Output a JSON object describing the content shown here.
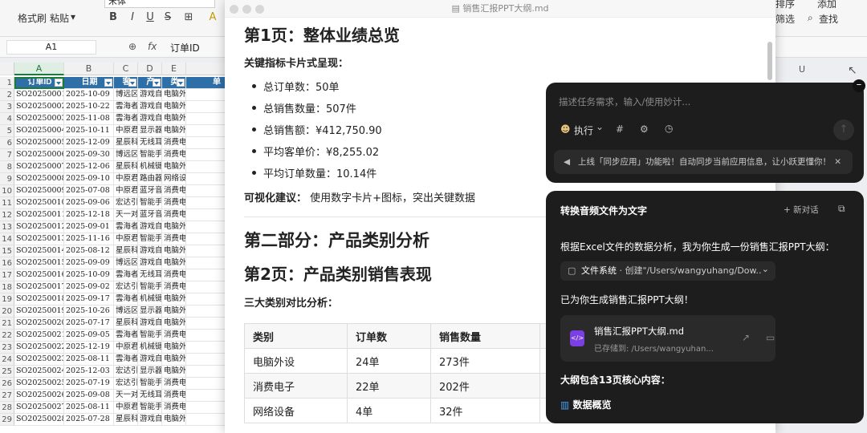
{
  "ribbon": {
    "format_painter": "格式刷",
    "paste": "粘贴",
    "paste_arrow": "▾",
    "font_name": "宋体",
    "bold": "B",
    "italic": "I",
    "underline": "U",
    "strike": "S",
    "border": "⊞",
    "fill": "A",
    "sort": "排序",
    "filter": "筛选",
    "find": "查找",
    "add": "添加"
  },
  "formula_bar": {
    "cell_ref": "A1",
    "fx": "fx",
    "zoom_icon": "⊕",
    "value": "订单ID"
  },
  "sheet": {
    "columns": [
      "A",
      "B",
      "C",
      "D",
      "E"
    ],
    "extra_columns": {
      "u": "U",
      "hidden_header": "单"
    },
    "header_row": [
      "订单ID",
      "日期",
      "客",
      "产",
      "类"
    ],
    "rows": [
      [
        "SO20250001",
        "2025-10-09",
        "博远区",
        "游戏自",
        "电脑外"
      ],
      [
        "SO20250002",
        "2025-10-22",
        "雲海者",
        "游戏自",
        "电脑外"
      ],
      [
        "SO20250003",
        "2025-11-08",
        "雲海者",
        "游戏自",
        "电脑外"
      ],
      [
        "SO20250004",
        "2025-10-11",
        "中原君",
        "显示器",
        "电脑外"
      ],
      [
        "SO20250005",
        "2025-12-09",
        "星辰科",
        "无线耳",
        "消费电"
      ],
      [
        "SO20250006",
        "2025-09-30",
        "博远区",
        "智能手",
        "消费电"
      ],
      [
        "SO20250007",
        "2025-12-06",
        "星辰科",
        "机械键",
        "电脑外"
      ],
      [
        "SO20250008",
        "2025-09-10",
        "中原君",
        "路由器",
        "网络设"
      ],
      [
        "SO20250009",
        "2025-07-08",
        "中原君",
        "蓝牙音",
        "消费电"
      ],
      [
        "SO20250010",
        "2025-09-06",
        "宏达引",
        "智能手",
        "消费电"
      ],
      [
        "SO20250011",
        "2025-12-18",
        "天一对",
        "蓝牙音",
        "消费电"
      ],
      [
        "SO20250012",
        "2025-09-01",
        "雲海者",
        "游戏自",
        "电脑外"
      ],
      [
        "SO20250013",
        "2025-11-16",
        "中原君",
        "智能手",
        "消费电"
      ],
      [
        "SO20250014",
        "2025-08-12",
        "星辰科",
        "游戏自",
        "电脑外"
      ],
      [
        "SO20250015",
        "2025-09-09",
        "博远区",
        "游戏自",
        "电脑外"
      ],
      [
        "SO20250016",
        "2025-10-09",
        "雲海者",
        "无线耳",
        "消费电"
      ],
      [
        "SO20250017",
        "2025-09-02",
        "宏达引",
        "智能手",
        "消费电"
      ],
      [
        "SO20250018",
        "2025-09-17",
        "雲海者",
        "机械键",
        "电脑外"
      ],
      [
        "SO20250019",
        "2025-10-26",
        "博远区",
        "显示器",
        "电脑外"
      ],
      [
        "SO20250020",
        "2025-07-17",
        "星辰科",
        "游戏自",
        "电脑外"
      ],
      [
        "SO20250021",
        "2025-09-05",
        "雲海者",
        "智能手",
        "消费电"
      ],
      [
        "SO20250022",
        "2025-12-19",
        "中原君",
        "机械键",
        "电脑外"
      ],
      [
        "SO20250023",
        "2025-08-11",
        "雲海者",
        "游戏自",
        "电脑外"
      ],
      [
        "SO20250024",
        "2025-12-03",
        "宏达引",
        "显示器",
        "电脑外"
      ],
      [
        "SO20250025",
        "2025-07-19",
        "宏达引",
        "智能手",
        "消费电"
      ],
      [
        "SO20250026",
        "2025-09-08",
        "天一对",
        "无线耳",
        "消费电"
      ],
      [
        "SO20250027",
        "2025-08-11",
        "中原君",
        "智能手",
        "消费电"
      ],
      [
        "SO20250028",
        "2025-07-28",
        "星辰科",
        "游戏自",
        "电脑外"
      ]
    ]
  },
  "markdown": {
    "window_title": "销售汇报PPT大纲.md",
    "page1_heading": "第1页：整体业绩总览",
    "kpi_intro": "关键指标卡片式呈现：",
    "kpis": [
      "总订单数：50单",
      "总销售数量：507件",
      "总销售额：¥412,750.90",
      "平均客单价：¥8,255.02",
      "平均订单数量：10.14件"
    ],
    "viz_label": "可视化建议：",
    "viz_text": "使用数字卡片+图标，突出关键数据",
    "part2_heading": "第二部分：产品类别分析",
    "page2_heading": "第2页：产品类别销售表现",
    "compare_intro": "三大类别对比分析：",
    "table_headers": [
      "类别",
      "订单数",
      "销售数量",
      "¥"
    ],
    "table_rows": [
      [
        "电脑外设",
        "24单",
        "273件",
        "¥"
      ],
      [
        "消费电子",
        "22单",
        "202件",
        "¥"
      ],
      [
        "网络设备",
        "4单",
        "32件",
        "¥"
      ]
    ]
  },
  "assistant": {
    "input_placeholder": "描述任务需求，输入/使用妙计...",
    "exec_label": "执行",
    "exec_arrow": "⌄",
    "hash": "#",
    "settings_icon": "⚙",
    "clock_icon": "◷",
    "send_icon": "↑",
    "notice": "上线「同步应用」功能啦！自动同步当前应用信息，让小跃更懂你！",
    "notice_close": "✕",
    "close": "–",
    "chat_title": "转换音频文件为文字",
    "new_chat": "+ 新对话",
    "open_icon": "⧉",
    "msg1": "根据Excel文件的数据分析，我为你生成一份销售汇报PPT大纲：",
    "tool_label": "文件系统",
    "tool_detail": "· 创建\"/Users/wangyuhang/Dow...",
    "tool_arrow": "⌄",
    "msg2": "已为你生成销售汇报PPT大纲！",
    "file_name": "销售汇报PPT大纲.md",
    "file_path": "已存储到: /Users/wangyuhan...",
    "file_icon": "</>",
    "open_file_icon": "↗",
    "folder_icon": "▭",
    "msg3": "大纲包含13页核心内容：",
    "section1": "数据概览",
    "section1_icon": "▥"
  }
}
